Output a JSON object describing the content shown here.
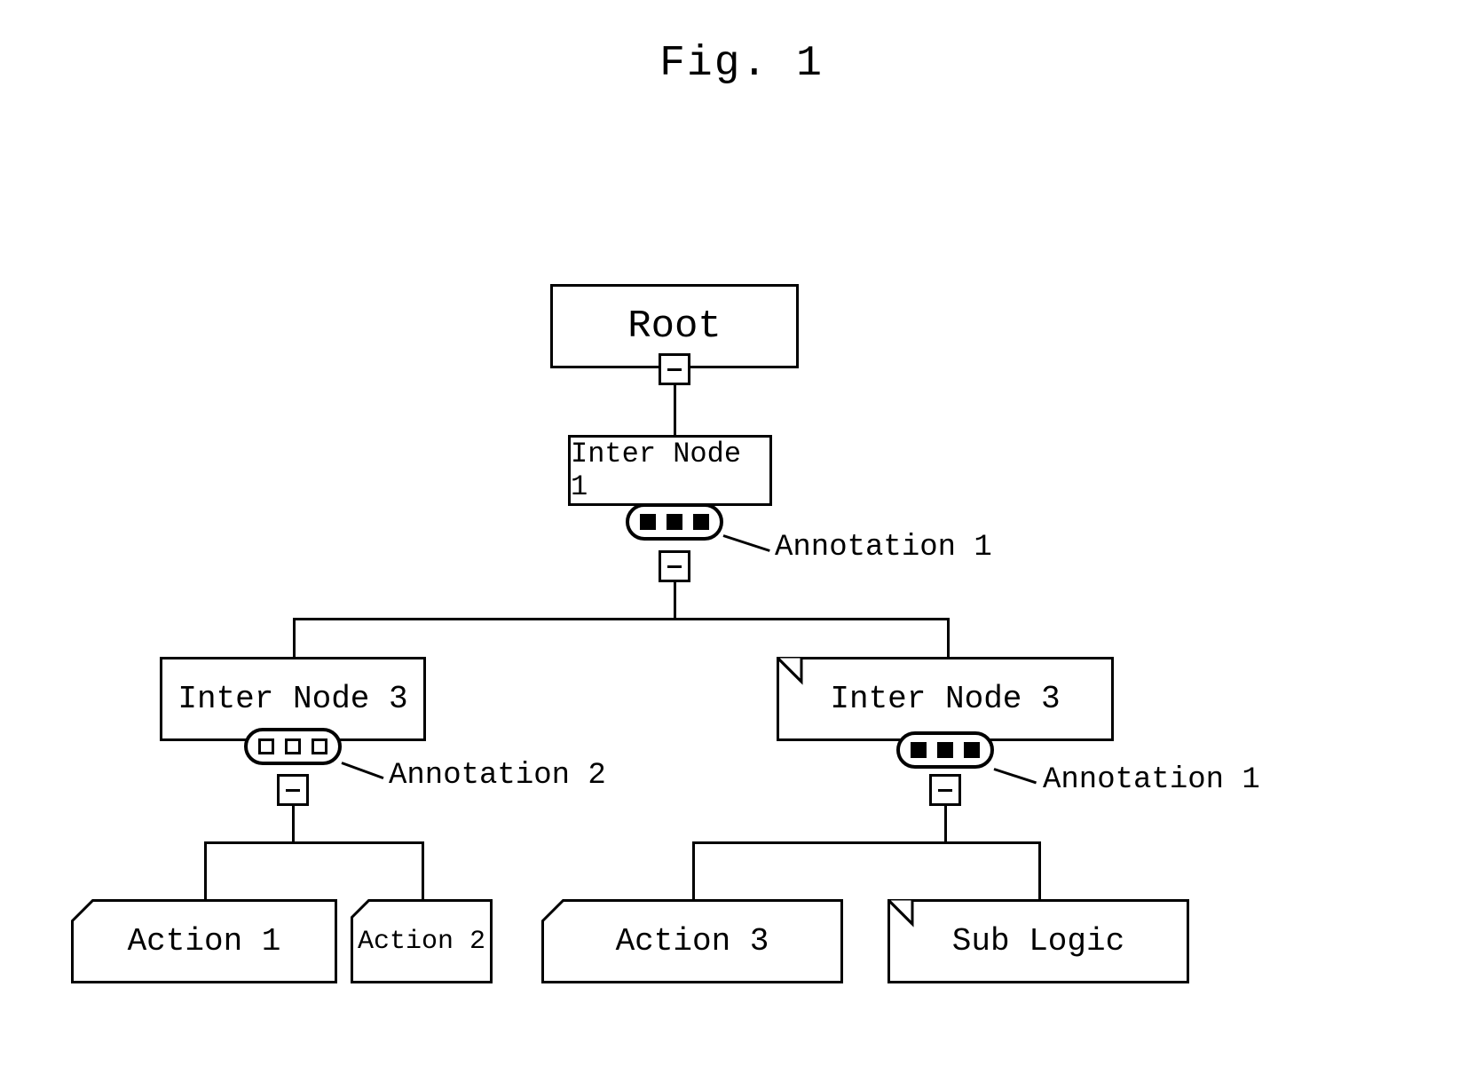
{
  "figure": {
    "title": "Fig. 1"
  },
  "nodes": {
    "root": "Root",
    "inter1": "Inter Node 1",
    "inter3_left": "Inter Node 3",
    "inter3_right": "Inter Node 3",
    "action1": "Action 1",
    "action2": "Action 2",
    "action3": "Action 3",
    "sublogic": "Sub Logic"
  },
  "annotations": {
    "a1_top": "Annotation 1",
    "a2": "Annotation 2",
    "a1_right": "Annotation 1"
  }
}
